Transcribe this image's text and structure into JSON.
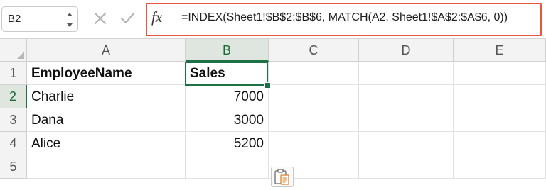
{
  "formula_bar": {
    "name_box": "B2",
    "fx_label": "fx",
    "formula": "=INDEX(Sheet1!$B$2:$B$6, MATCH(A2, Sheet1!$A$2:$A$6, 0))",
    "highlight_color": "#e8563e"
  },
  "grid": {
    "columns": [
      "A",
      "B",
      "C",
      "D",
      "E"
    ],
    "rows": [
      "1",
      "2",
      "3",
      "4",
      "5"
    ],
    "selected_column": "B",
    "selected_row": "2",
    "cells": {
      "A1": "EmployeeName",
      "B1": "Sales",
      "A2": "Charlie",
      "B2": "7000",
      "A3": "Dana",
      "B3": "3000",
      "A4": "Alice",
      "B4": "5200"
    },
    "active_cell": "B2",
    "accent_color": "#1e7145"
  },
  "icons": {
    "stepper": "stepper-arrows-icon",
    "cancel": "cancel-x-icon",
    "confirm": "confirm-check-icon",
    "paste_options": "paste-options-icon"
  }
}
